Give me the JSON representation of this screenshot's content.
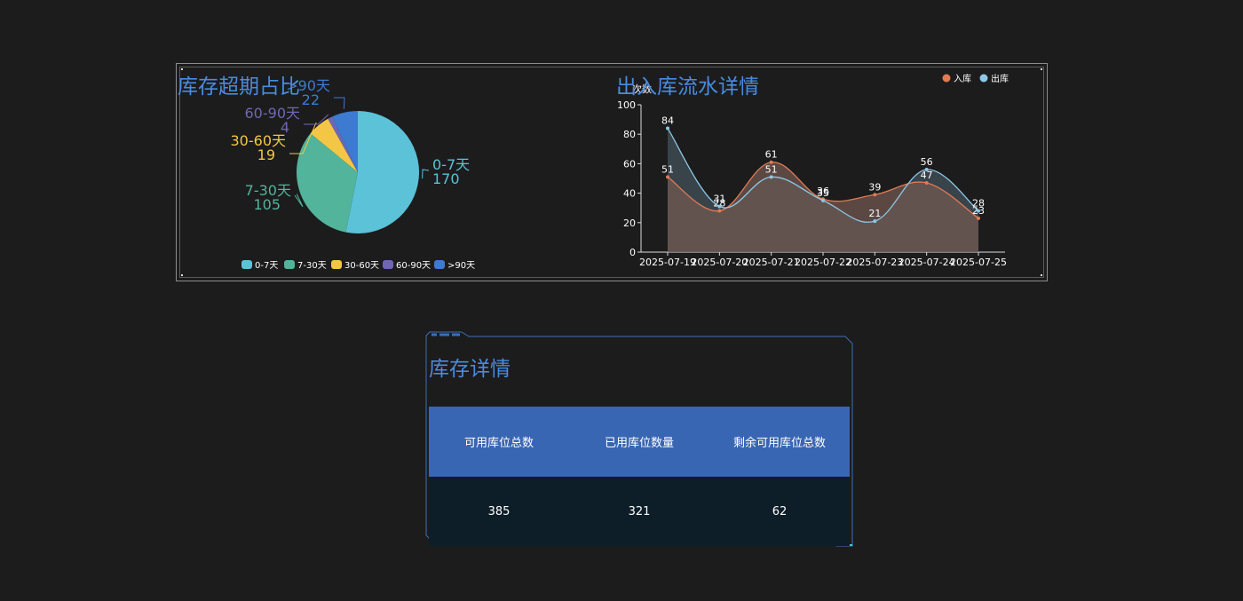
{
  "pie_title": "库存超期占比",
  "line_title": "出入库流水详情",
  "detail_title": "库存详情",
  "colors": {
    "title": "#4a8be0",
    "in": "#e07b54",
    "out": "#8ec8e6",
    "pie": [
      "#5bc2d8",
      "#52b49b",
      "#f3c745",
      "#6f67b5",
      "#3c7bcf"
    ]
  },
  "chart_data": [
    {
      "type": "pie",
      "title": "库存超期占比",
      "categories": [
        "0-7天",
        "7-30天",
        "30-60天",
        "60-90天",
        ">90天"
      ],
      "values": [
        170,
        105,
        19,
        4,
        22
      ],
      "legend_position": "bottom"
    },
    {
      "type": "area",
      "title": "出入库流水详情",
      "ylabel": "次数",
      "ylim": [
        0,
        100
      ],
      "yticks": [
        0,
        20,
        40,
        60,
        80,
        100
      ],
      "x": [
        "2025-07-19",
        "2025-07-20",
        "2025-07-21",
        "2025-07-22",
        "2025-07-23",
        "2025-07-24",
        "2025-07-25"
      ],
      "series": [
        {
          "name": "入库",
          "values": [
            51,
            28,
            61,
            36,
            39,
            47,
            23
          ]
        },
        {
          "name": "出库",
          "values": [
            84,
            31,
            51,
            35,
            21,
            56,
            28
          ]
        }
      ],
      "legend_position": "top-right"
    }
  ],
  "table": {
    "headers": [
      "可用库位总数",
      "已用库位数量",
      "剩余可用库位总数"
    ],
    "rows": [
      [
        "385",
        "321",
        "62"
      ]
    ]
  }
}
